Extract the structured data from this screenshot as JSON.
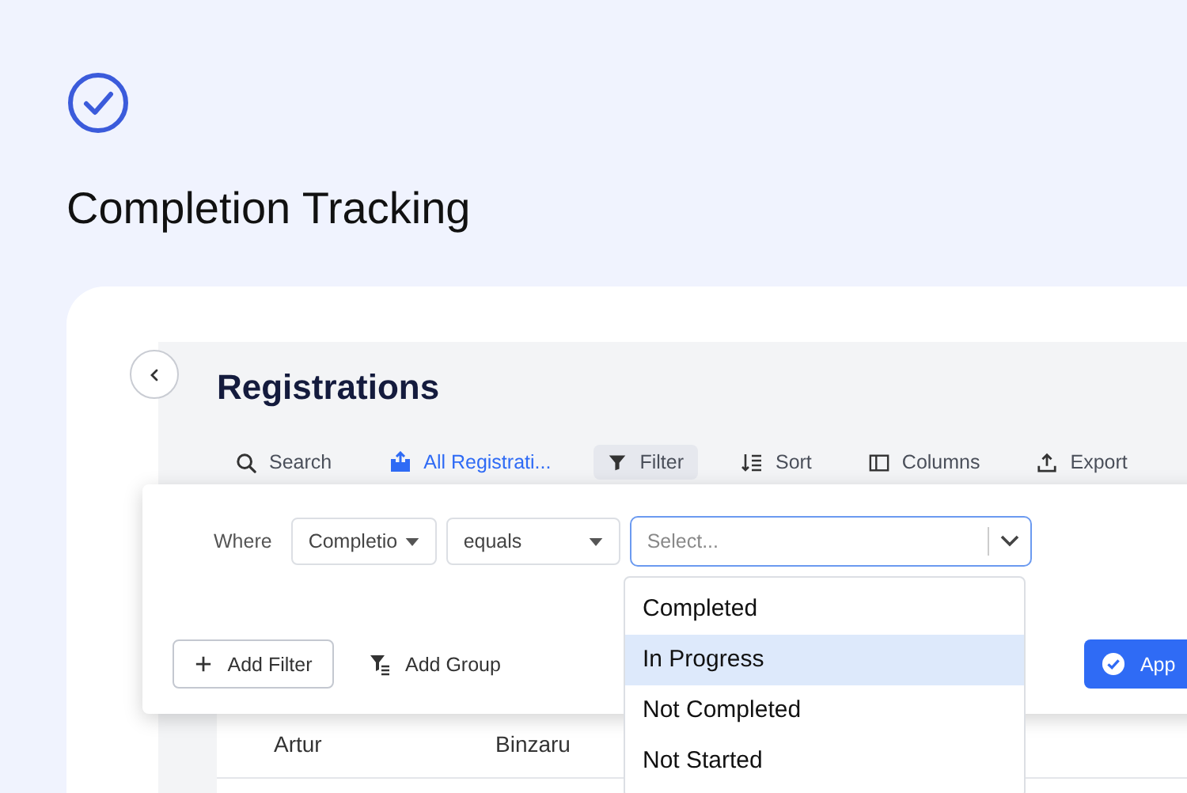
{
  "header": {
    "title": "Completion Tracking"
  },
  "page": {
    "title": "Registrations"
  },
  "toolbar": [
    {
      "label": "Search",
      "kind": "search",
      "selected": false
    },
    {
      "label": "All Registrati...",
      "kind": "view",
      "selected": false
    },
    {
      "label": "Filter",
      "kind": "filter",
      "selected": true
    },
    {
      "label": "Sort",
      "kind": "sort",
      "selected": false
    },
    {
      "label": "Columns",
      "kind": "columns",
      "selected": false
    },
    {
      "label": "Export",
      "kind": "export",
      "selected": false
    }
  ],
  "filter": {
    "label": "Where",
    "field": "Completio",
    "operator": "equals",
    "placeholder": "Select...",
    "options": [
      {
        "label": "Completed",
        "selected": false
      },
      {
        "label": "In Progress",
        "selected": true
      },
      {
        "label": "Not Completed",
        "selected": false
      },
      {
        "label": "Not Started",
        "selected": false
      }
    ],
    "add_filter": "Add Filter",
    "add_group": "Add Group",
    "apply": "App"
  },
  "table": {
    "rows": [
      {
        "cells": [
          "Artur",
          "Binzaru"
        ]
      }
    ]
  }
}
